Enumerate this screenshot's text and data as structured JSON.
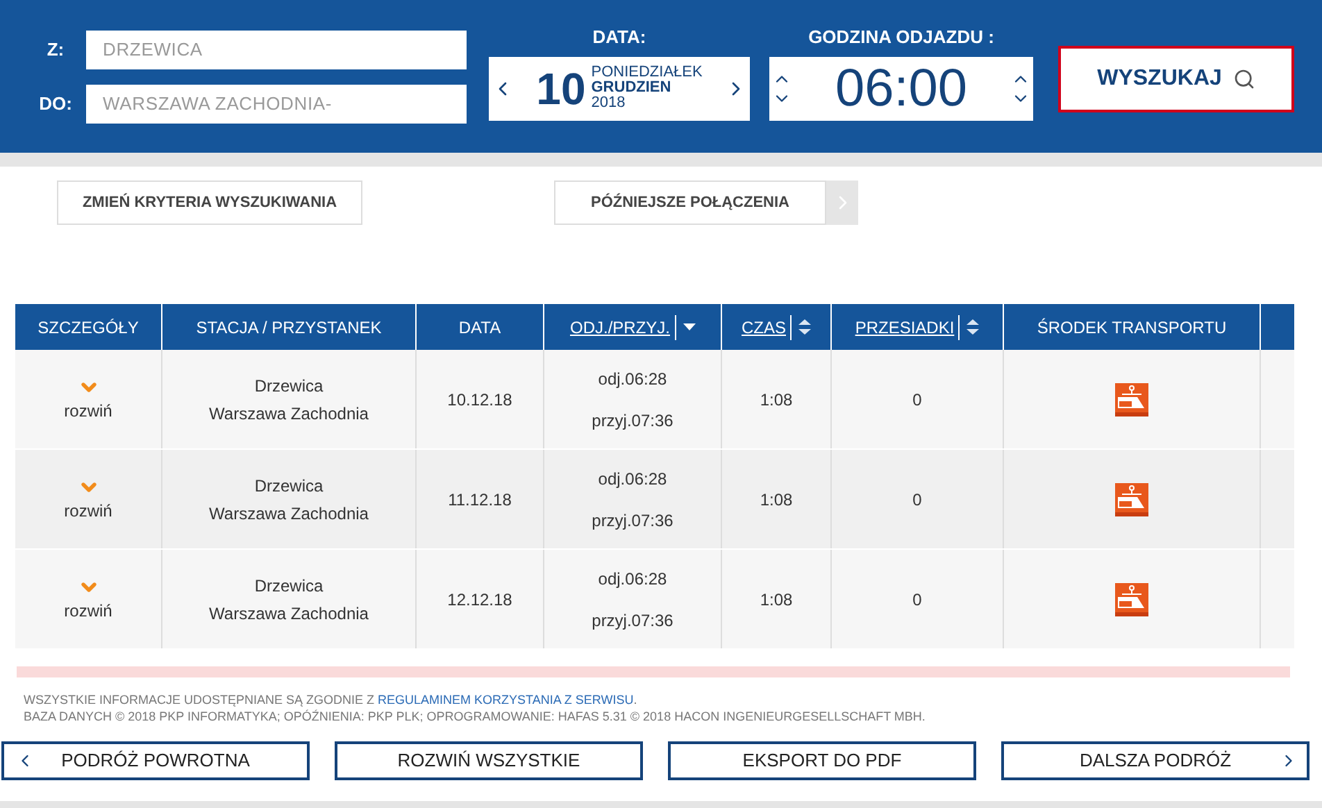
{
  "search": {
    "from_label": "Z:",
    "from_value": "DRZEWICA",
    "to_label": "DO:",
    "to_value": "WARSZAWA ZACHODNIA-",
    "date_label": "DATA:",
    "day": "10",
    "weekday": "PONIEDZIAŁEK",
    "month": "GRUDZIEN",
    "year": "2018",
    "time_label": "GODZINA ODJAZDU :",
    "time": "06:00",
    "search_button": "WYSZUKAJ"
  },
  "actions": {
    "change_criteria": "ZMIEŃ KRYTERIA WYSZUKIWANIA",
    "later": "PÓŹNIEJSZE POŁĄCZENIA"
  },
  "table": {
    "columns": [
      {
        "label": "SZCZEGÓŁY",
        "kind": "plain"
      },
      {
        "label": "STACJA / PRZYSTANEK",
        "kind": "plain"
      },
      {
        "label": "DATA",
        "kind": "plain"
      },
      {
        "label": "ODJ./PRZYJ.",
        "kind": "sorted"
      },
      {
        "label": "CZAS",
        "kind": "sortable"
      },
      {
        "label": "PRZESIADKI",
        "kind": "sortable"
      },
      {
        "label": "ŚRODEK TRANSPORTU",
        "kind": "plain"
      }
    ],
    "rows": [
      {
        "expand": "rozwiń",
        "from": "Drzewica",
        "to": "Warszawa Zachodnia",
        "date": "10.12.18",
        "dep": "odj.06:28",
        "arr": "przyj.07:36",
        "duration": "1:08",
        "changes": "0"
      },
      {
        "expand": "rozwiń",
        "from": "Drzewica",
        "to": "Warszawa Zachodnia",
        "date": "11.12.18",
        "dep": "odj.06:28",
        "arr": "przyj.07:36",
        "duration": "1:08",
        "changes": "0"
      },
      {
        "expand": "rozwiń",
        "from": "Drzewica",
        "to": "Warszawa Zachodnia",
        "date": "12.12.18",
        "dep": "odj.06:28",
        "arr": "przyj.07:36",
        "duration": "1:08",
        "changes": "0"
      }
    ]
  },
  "footer": {
    "info_before": "WSZYSTKIE INFORMACJE UDOSTĘPNIANE SĄ ZGODNIE Z",
    "info_link": "REGULAMINEM KORZYSTANIA Z SERWISU",
    "info_after": ".",
    "credits": "BAZA DANYCH © 2018 PKP INFORMATYKA; OPÓŹNIENIA: PKP PLK; OPROGRAMOWANIE: HAFAS 5.31 © 2018 HACON INGENIEURGESELLSCHAFT MBH."
  },
  "buttons": [
    {
      "label": "PODRÓŻ POWROTNA",
      "kind": "back"
    },
    {
      "label": "ROZWIŃ WSZYSTKIE",
      "kind": "plain"
    },
    {
      "label": "EKSPORT DO PDF",
      "kind": "plain"
    },
    {
      "label": "DALSZA PODRÓŻ",
      "kind": "forward"
    }
  ]
}
